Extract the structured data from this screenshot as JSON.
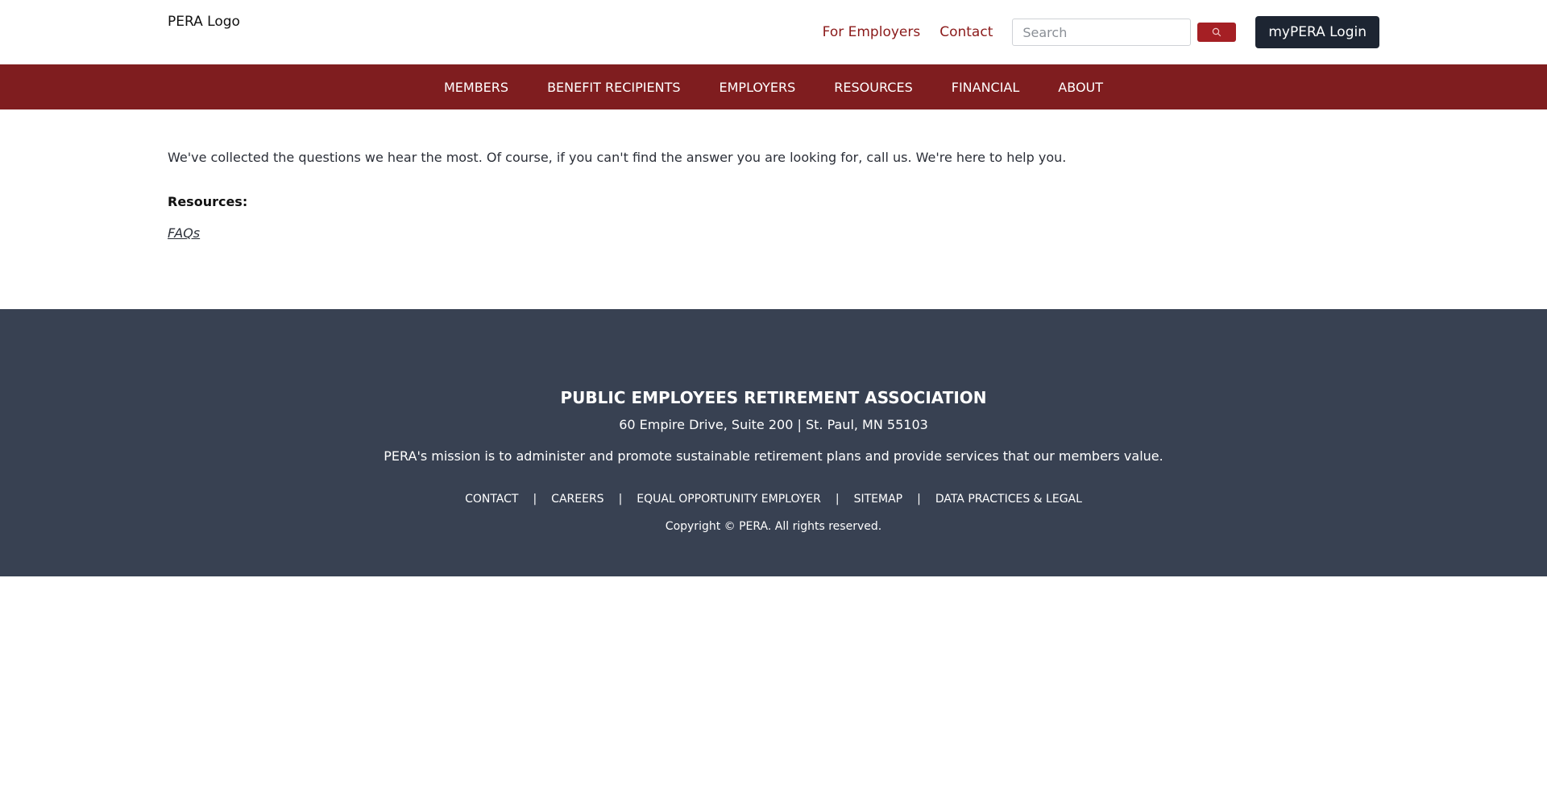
{
  "header": {
    "logo_text": "PERA Logo",
    "links": [
      "For Employers",
      "Contact"
    ],
    "search_placeholder": "Search",
    "search_icon": "search-icon",
    "login_label": "myPERA Login"
  },
  "nav": {
    "items": [
      "MEMBERS",
      "BENEFIT RECIPIENTS",
      "EMPLOYERS",
      "RESOURCES",
      "FINANCIAL",
      "ABOUT"
    ]
  },
  "main": {
    "intro": "We've collected the questions we hear the most. Of course, if you can't find the answer you are looking for, call us. We're here to help you.",
    "resources_heading": "Resources:",
    "resources_link": "FAQs"
  },
  "footer": {
    "org_name": "PUBLIC EMPLOYEES RETIREMENT ASSOCIATION",
    "address": "60 Empire Drive, Suite 200 | St. Paul, MN 55103",
    "mission": "PERA's mission is to administer and promote sustainable retirement plans and provide services that our members value.",
    "links": [
      "CONTACT",
      "CAREERS",
      "EQUAL OPPORTUNITY EMPLOYER",
      "SITEMAP",
      "DATA PRACTICES & LEGAL"
    ],
    "separator": "|",
    "copyright": "Copyright © PERA. All rights reserved."
  },
  "colors": {
    "brand_red": "#7f1d1f",
    "link_red": "#8b1a1a",
    "search_button": "#a51f24",
    "login_bg": "#1d2532",
    "footer_bg": "#384152"
  }
}
